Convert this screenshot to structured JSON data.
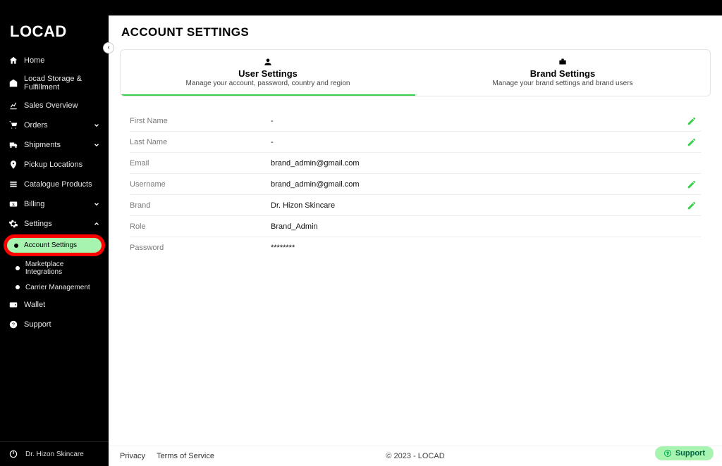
{
  "brand_logo": "LOCAD",
  "collapse_icon": "‹",
  "sidebar": {
    "items": [
      {
        "label": "Home"
      },
      {
        "label": "Locad Storage & Fulfillment"
      },
      {
        "label": "Sales Overview"
      },
      {
        "label": "Orders"
      },
      {
        "label": "Shipments"
      },
      {
        "label": "Pickup Locations"
      },
      {
        "label": "Catalogue Products"
      },
      {
        "label": "Billing"
      },
      {
        "label": "Settings"
      }
    ],
    "settings_children": [
      {
        "label": "Account Settings"
      },
      {
        "label": "Marketplace Integrations"
      },
      {
        "label": "Carrier Management"
      }
    ],
    "wallet": "Wallet",
    "support": "Support",
    "footer_user": "Dr. Hizon Skincare"
  },
  "page": {
    "title": "ACCOUNT SETTINGS"
  },
  "tabs": [
    {
      "title": "User Settings",
      "subtitle": "Manage your account, password, country and region",
      "icon": "user"
    },
    {
      "title": "Brand Settings",
      "subtitle": "Manage your brand settings and brand users",
      "icon": "briefcase"
    }
  ],
  "fields": {
    "first_name": {
      "label": "First Name",
      "value": "-",
      "editable": true
    },
    "last_name": {
      "label": "Last Name",
      "value": "-",
      "editable": true
    },
    "email": {
      "label": "Email",
      "value": "brand_admin@gmail.com",
      "editable": false
    },
    "username": {
      "label": "Username",
      "value": "brand_admin@gmail.com",
      "editable": true
    },
    "brand": {
      "label": "Brand",
      "value": "Dr. Hizon Skincare",
      "editable": true
    },
    "role": {
      "label": "Role",
      "value": "Brand_Admin",
      "editable": false
    },
    "password": {
      "label": "Password",
      "value": "********",
      "editable": false
    }
  },
  "footer": {
    "privacy": "Privacy",
    "terms": "Terms of Service",
    "copyright": "© 2023 - LOCAD",
    "support": "Support"
  },
  "colors": {
    "accent": "#3ccf4e",
    "highlight_bg": "#a7f3b0",
    "highlight_border": "#ff0000"
  }
}
